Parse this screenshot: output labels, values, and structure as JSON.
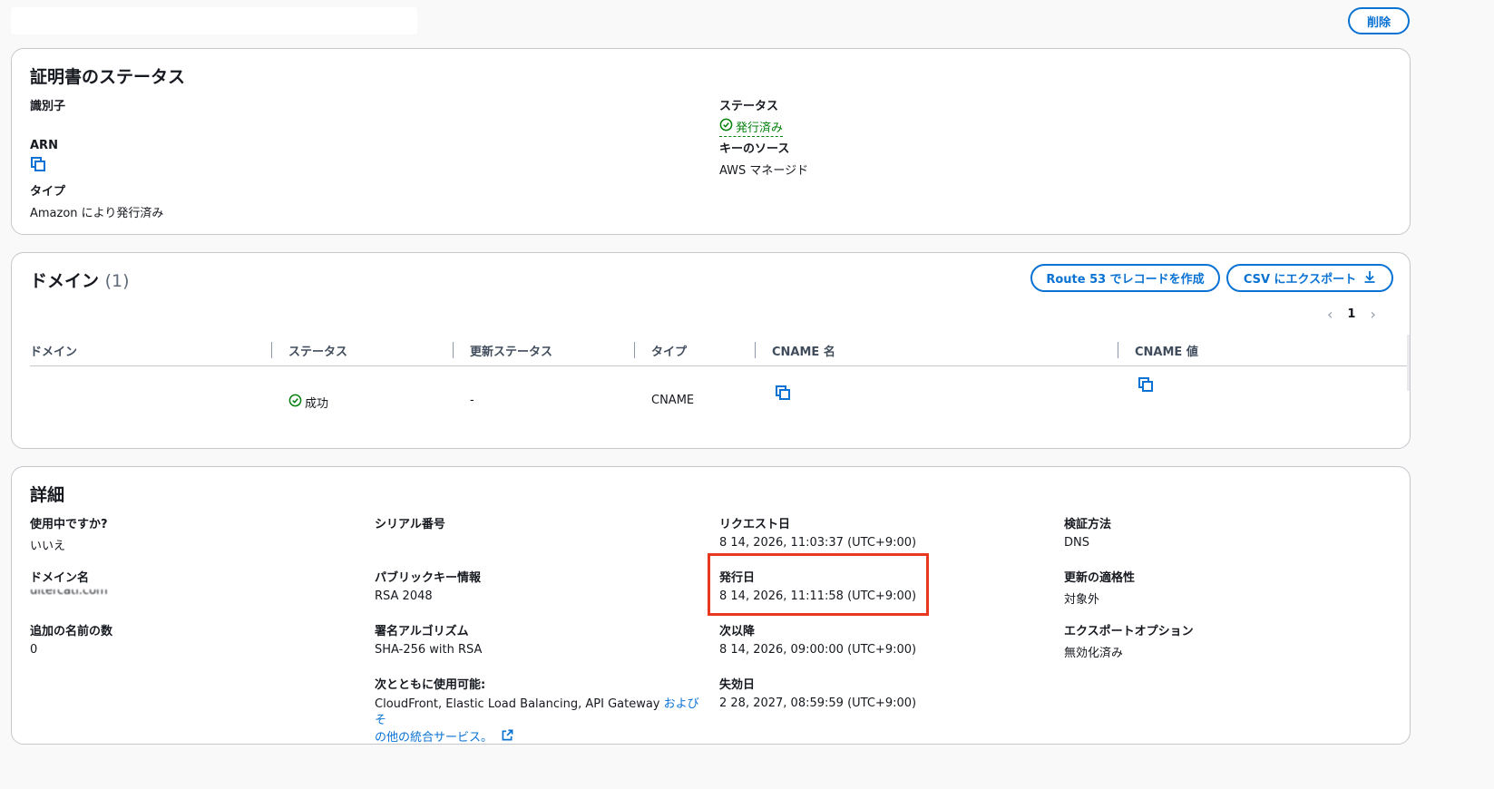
{
  "header": {
    "delete_label": "削除"
  },
  "status_card": {
    "title": "証明書のステータス",
    "identifier_label": "識別子",
    "identifier_value": "",
    "arn_label": "ARN",
    "type_label": "タイプ",
    "type_value": "Amazon により発行済み",
    "status_label": "ステータス",
    "status_value": "発行済み",
    "key_source_label": "キーのソース",
    "key_source_value": "AWS マネージド"
  },
  "domains_card": {
    "title": "ドメイン",
    "count": "(1)",
    "route53_button": "Route 53 でレコードを作成",
    "csv_button": "CSV にエクスポート",
    "page_number": "1",
    "columns": [
      "ドメイン",
      "ステータス",
      "更新ステータス",
      "タイプ",
      "CNAME 名",
      "CNAME 値"
    ],
    "rows": [
      {
        "domain": "",
        "status": "成功",
        "renewal_status": "-",
        "type": "CNAME"
      }
    ]
  },
  "details_card": {
    "title": "詳細",
    "in_use_label": "使用中ですか?",
    "in_use_value": "いいえ",
    "domain_name_label": "ドメイン名",
    "domain_name_value": "ultercati.com",
    "additional_names_label": "追加の名前の数",
    "additional_names_value": "0",
    "serial_label": "シリアル番号",
    "serial_value": "",
    "public_key_label": "パブリックキー情報",
    "public_key_value": "RSA 2048",
    "signature_label": "署名アルゴリズム",
    "signature_value": "SHA-256 with RSA",
    "usable_with_label": "次とともに使用可能:",
    "usable_with_text": "CloudFront, Elastic Load Balancing, API Gateway ",
    "usable_with_link_1": "およびそ",
    "usable_with_link_2": "の他の統合サービス。",
    "requested_label": "リクエスト日",
    "requested_value": "8 14, 2026, 11:03:37 (UTC+9:00)",
    "issued_label": "発行日",
    "issued_value": "8 14, 2026, 11:11:58 (UTC+9:00)",
    "not_before_label": "次以降",
    "not_before_value": "8 14, 2026, 09:00:00 (UTC+9:00)",
    "not_after_label": "失効日",
    "not_after_value": "2 28, 2027, 08:59:59 (UTC+9:00)",
    "validation_label": "検証方法",
    "validation_value": "DNS",
    "renewal_label": "更新の適格性",
    "renewal_value": "対象外",
    "export_label": "エクスポートオプション",
    "export_value": "無効化済み"
  },
  "colors": {
    "accent": "#0972d3",
    "success": "#037f0c",
    "highlight": "#e8381f"
  }
}
